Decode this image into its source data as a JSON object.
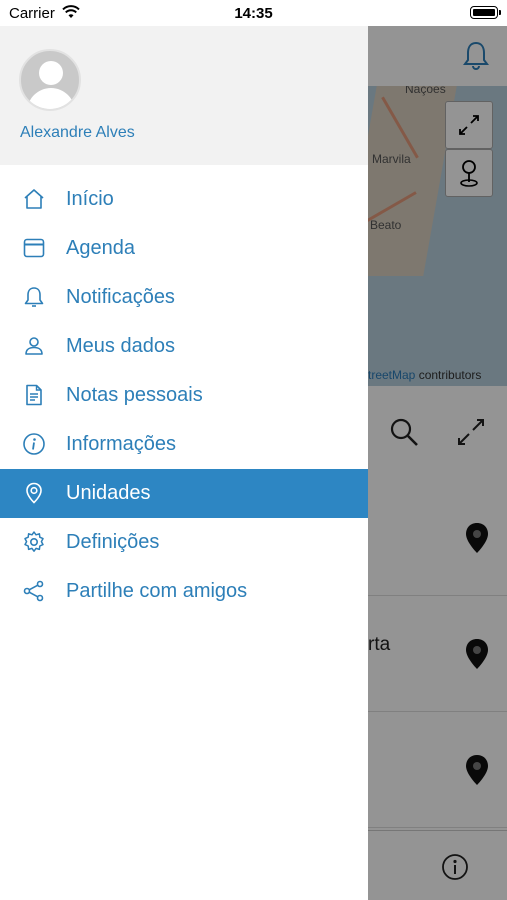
{
  "status_bar": {
    "carrier": "Carrier",
    "time": "14:35"
  },
  "drawer": {
    "user_name": "Alexandre Alves",
    "items": [
      {
        "label": "Início",
        "icon": "home-icon"
      },
      {
        "label": "Agenda",
        "icon": "calendar-icon"
      },
      {
        "label": "Notificações",
        "icon": "bell-icon"
      },
      {
        "label": "Meus dados",
        "icon": "user-icon"
      },
      {
        "label": "Notas pessoais",
        "icon": "document-icon"
      },
      {
        "label": "Informações",
        "icon": "info-icon"
      },
      {
        "label": "Unidades",
        "icon": "location-pin-icon",
        "active": true
      },
      {
        "label": "Definições",
        "icon": "gear-icon"
      },
      {
        "label": "Partilhe com amigos",
        "icon": "share-icon"
      }
    ]
  },
  "background": {
    "map_labels": [
      "Nações",
      "Marvila",
      "Beato"
    ],
    "attribution_link": "StreetMap",
    "attribution_text": "contributors",
    "list_partial_text": "rta"
  },
  "colors": {
    "accent": "#2d7fb8",
    "active_bg": "#2d86c3"
  }
}
